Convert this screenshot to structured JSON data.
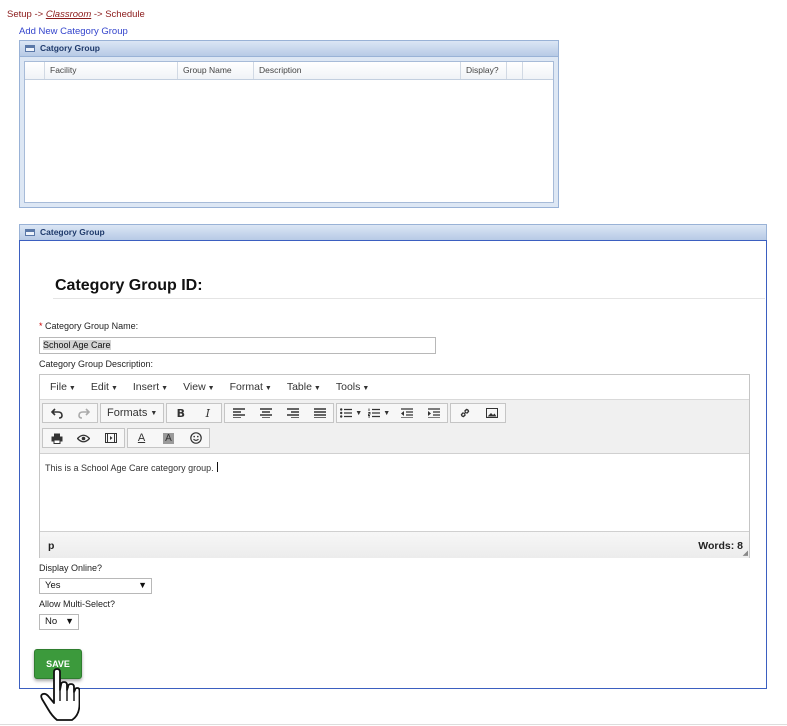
{
  "breadcrumb": {
    "setup": "Setup ->",
    "classroom": "Classroom",
    "schedule": "-> Schedule"
  },
  "add_link": "Add New Category Group",
  "grid_panel": {
    "title": "Catgory Group",
    "columns": [
      "",
      "Facility",
      "Group Name",
      "Description",
      "Display?",
      ""
    ]
  },
  "form_panel": {
    "title": "Category Group",
    "heading": "Category Group ID:",
    "name_required_mark": "*",
    "name_label": "Category Group Name:",
    "name_value": "School Age Care",
    "description_label": "Category Group Description:",
    "editor": {
      "menus": [
        "File",
        "Edit",
        "Insert",
        "View",
        "Format",
        "Table",
        "Tools"
      ],
      "formats_label": "Formats",
      "content": "This is a School Age Care category group.",
      "path": "p",
      "word_count": "Words: 8"
    },
    "display_online_label": "Display Online?",
    "display_online_value": "Yes",
    "multi_select_label": "Allow Multi-Select?",
    "multi_select_value": "No",
    "save_label": "SAVE"
  }
}
